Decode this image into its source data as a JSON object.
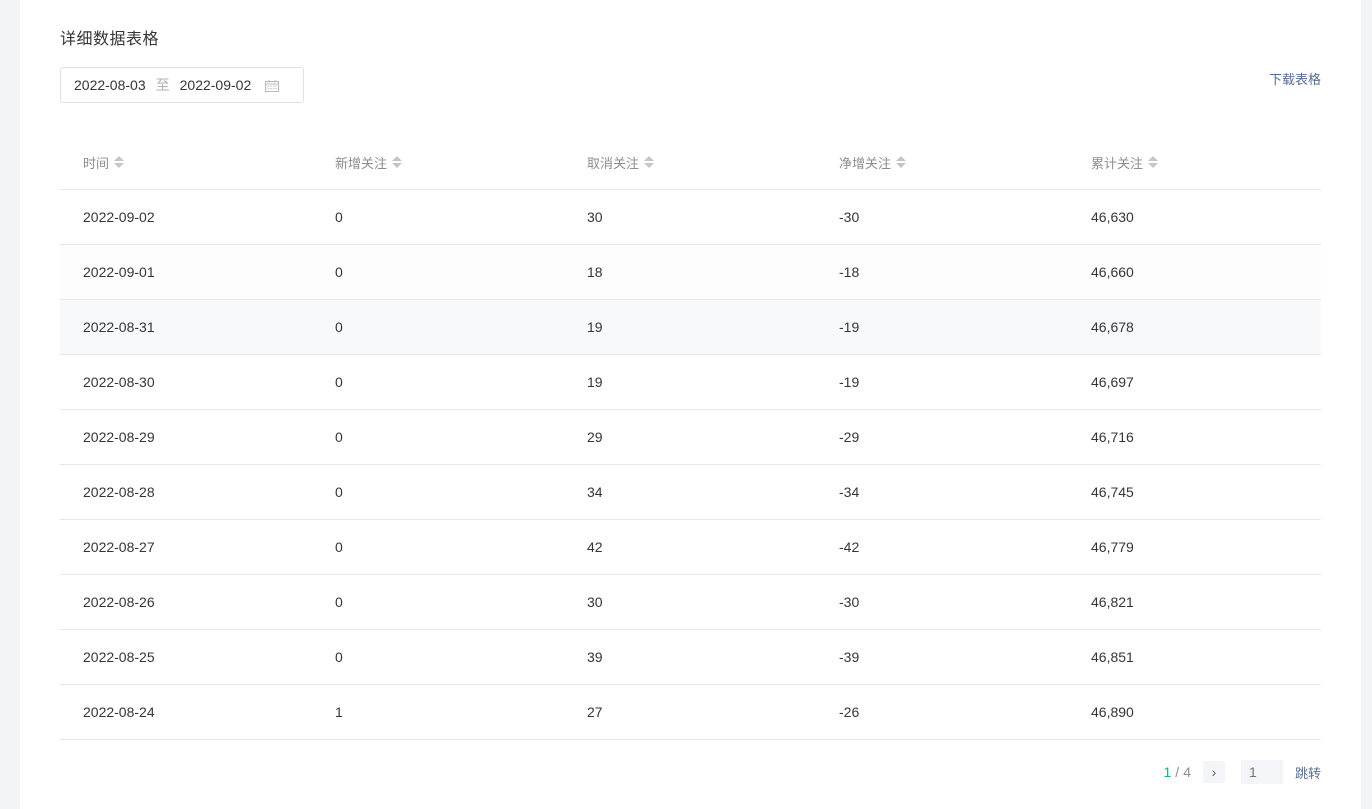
{
  "title": "详细数据表格",
  "date_range": {
    "start": "2022-08-03",
    "separator": "至",
    "end": "2022-09-02"
  },
  "download_label": "下载表格",
  "table": {
    "headers": [
      "时间",
      "新增关注",
      "取消关注",
      "净增关注",
      "累计关注"
    ],
    "rows": [
      [
        "2022-09-02",
        "0",
        "30",
        "-30",
        "46,630"
      ],
      [
        "2022-09-01",
        "0",
        "18",
        "-18",
        "46,660"
      ],
      [
        "2022-08-31",
        "0",
        "19",
        "-19",
        "46,678"
      ],
      [
        "2022-08-30",
        "0",
        "19",
        "-19",
        "46,697"
      ],
      [
        "2022-08-29",
        "0",
        "29",
        "-29",
        "46,716"
      ],
      [
        "2022-08-28",
        "0",
        "34",
        "-34",
        "46,745"
      ],
      [
        "2022-08-27",
        "0",
        "42",
        "-42",
        "46,779"
      ],
      [
        "2022-08-26",
        "0",
        "30",
        "-30",
        "46,821"
      ],
      [
        "2022-08-25",
        "0",
        "39",
        "-39",
        "46,851"
      ],
      [
        "2022-08-24",
        "1",
        "27",
        "-26",
        "46,890"
      ]
    ]
  },
  "pagination": {
    "current": "1",
    "separator": "/",
    "total": "4",
    "next_icon": "›",
    "jump_placeholder": "1",
    "jump_label": "跳转"
  },
  "colors": {
    "accent": "#07c160",
    "link": "#576b95"
  }
}
